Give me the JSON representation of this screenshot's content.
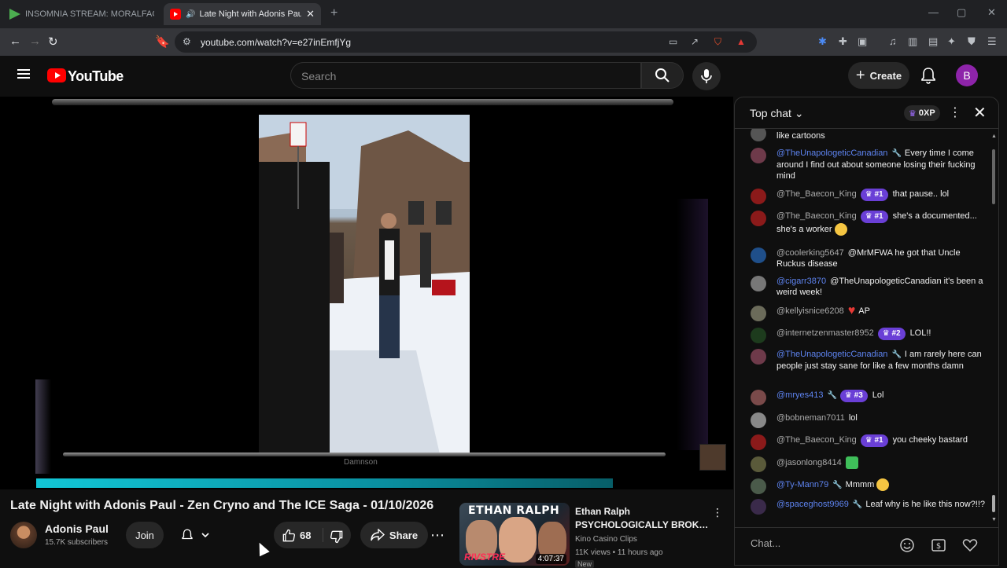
{
  "browser": {
    "tabs": [
      {
        "label": "INSOMNIA STREAM: MORALFAG EDITION"
      },
      {
        "label": "Late Night with Adonis Paul - Zen Cryno and The ICE Saga"
      }
    ],
    "url": "youtube.com/watch?v=e27inEmfjYg"
  },
  "youtube": {
    "logo_text": "YouTube",
    "search_placeholder": "Search",
    "create_label": "Create",
    "avatar_letter": "B"
  },
  "video": {
    "caption": "Damnson",
    "progress_fraction": 0.79,
    "title": "Late Night with Adonis Paul - Zen Cryno and The ICE Saga - 01/10/2026",
    "channel": "Adonis Paul",
    "subscribers": "15.7K subscribers",
    "join_label": "Join",
    "likes": "68",
    "share_label": "Share"
  },
  "recommended": {
    "thumb_title": "ETHAN RALPH",
    "thumb_brand": "RIVSTRE",
    "duration": "4:07:37",
    "title_line1": "Ethan Ralph",
    "title_line2": "PSYCHOLOGICALLY BROKEN ...",
    "channel": "Kino Casino Clips",
    "meta": "11K views • 11 hours ago",
    "badge": "New"
  },
  "chat": {
    "header": "Top chat",
    "xp": "0XP",
    "input_placeholder": "Chat...",
    "messages": [
      {
        "user": "",
        "text": "like cartoons"
      },
      {
        "user": "@TheUnapologeticCanadian",
        "text": "Every time I come around I find out about someone losing their fucking mind"
      },
      {
        "user": "@The_Baecon_King",
        "badge": "#1",
        "text": "that pause.. lol"
      },
      {
        "user": "@The_Baecon_King",
        "badge": "#1",
        "text": "she's a documented... she's a worker"
      },
      {
        "user": "@coolerking5647",
        "text": "@MrMFWA he got that Uncle Ruckus disease"
      },
      {
        "user": "@cigarr3870",
        "text": "@TheUnapologeticCanadian it's been a weird week!"
      },
      {
        "user": "@kellyisnice6208",
        "text": "AP"
      },
      {
        "user": "@internetzenmaster8952",
        "badge": "#2",
        "text": "LOL!!"
      },
      {
        "user": "@TheUnapologeticCanadian",
        "text": "I am rarely here can people just stay sane for like a few months damn"
      },
      {
        "user": "@mryes413",
        "badge": "#3",
        "text": "Lol"
      },
      {
        "user": "@bobneman7011",
        "text": "lol"
      },
      {
        "user": "@The_Baecon_King",
        "badge": "#1",
        "text": "you cheeky bastard"
      },
      {
        "user": "@jasonlong8414",
        "text": ""
      },
      {
        "user": "@Ty-Mann79",
        "text": "Mmmm"
      },
      {
        "user": "@spaceghost9969",
        "text": "Leaf why is he like this now?!!?"
      }
    ]
  }
}
